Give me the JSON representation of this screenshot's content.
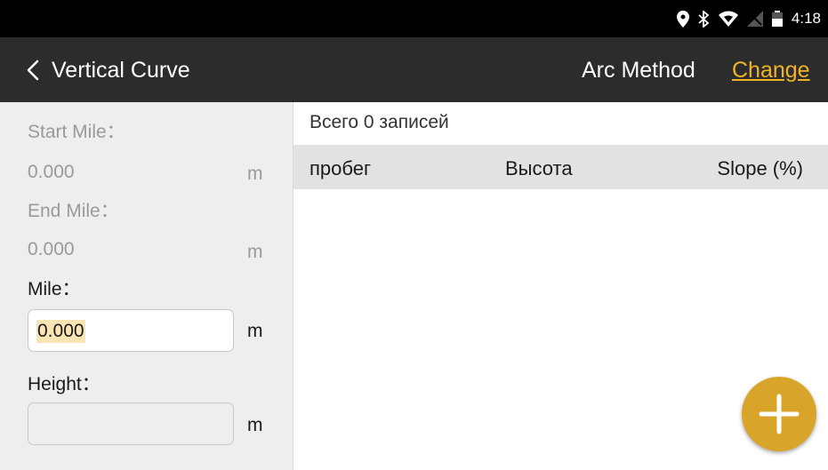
{
  "status_bar": {
    "time": "4:18",
    "icons": [
      "location-icon",
      "bluetooth-icon",
      "wifi-icon",
      "no-signal-icon",
      "battery-icon"
    ]
  },
  "app_bar": {
    "title": "Vertical Curve",
    "method": "Arc Method",
    "change_label": "Change",
    "accent_color": "#f0b422",
    "background": "#2c2c2c"
  },
  "left_panel": {
    "start_mile_label": "Start Mile：",
    "start_mile_value": "0.000",
    "start_mile_unit": "m",
    "end_mile_label": "End Mile：",
    "end_mile_value": "0.000",
    "end_mile_unit": "m",
    "mile_label": "Mile：",
    "mile_value": "0.000",
    "mile_unit": "m",
    "height_label": "Height：",
    "height_value": "",
    "height_unit": "m"
  },
  "records": {
    "summary": "Всего 0 записей",
    "columns": [
      "пробег",
      "Высота",
      "Slope (%)"
    ],
    "rows": []
  },
  "fab": {
    "icon": "plus-icon",
    "color": "#d8a42a"
  }
}
